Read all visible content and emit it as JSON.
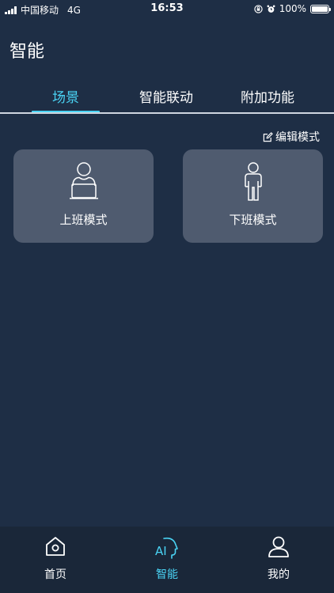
{
  "status_bar": {
    "carrier": "中国移动",
    "network": "4G",
    "time": "16:53",
    "battery_percent": "100%",
    "icons": [
      "signal-icon",
      "orientation-lock-icon",
      "alarm-icon",
      "battery-icon"
    ]
  },
  "header": {
    "title": "智能"
  },
  "tabs": [
    {
      "label": "场景",
      "active": true
    },
    {
      "label": "智能联动",
      "active": false
    },
    {
      "label": "附加功能",
      "active": false
    }
  ],
  "edit_mode": {
    "label": "编辑模式",
    "icon": "edit-icon"
  },
  "scenes": [
    {
      "label": "上班模式",
      "icon": "person-at-laptop-icon"
    },
    {
      "label": "下班模式",
      "icon": "person-standing-icon"
    }
  ],
  "bottom_nav": [
    {
      "label": "首页",
      "icon": "home-icon",
      "active": false
    },
    {
      "label": "智能",
      "icon": "ai-head-icon",
      "active": true
    },
    {
      "label": "我的",
      "icon": "user-icon",
      "active": false
    }
  ],
  "colors": {
    "background": "#1e2e45",
    "accent": "#4ad4f5",
    "card": "#4f5b6f",
    "nav_background": "#1a2739"
  }
}
